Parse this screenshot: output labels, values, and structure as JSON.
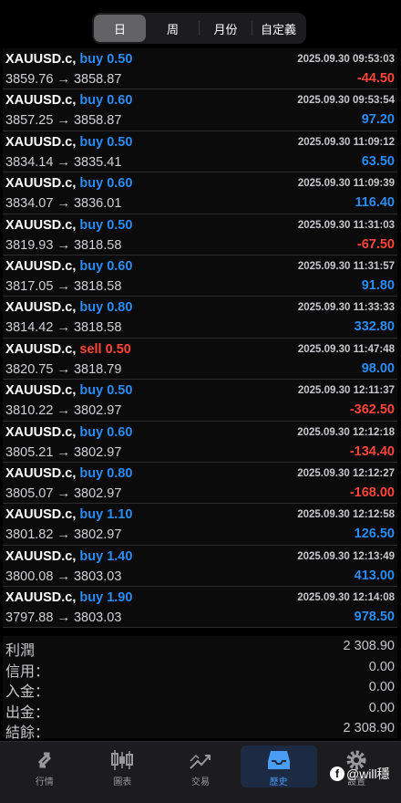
{
  "segments": [
    "日",
    "周",
    "月份",
    "自定義"
  ],
  "trades": [
    {
      "symbol": "XAUUSD.c,",
      "side": "buy",
      "lot": "0.50",
      "time": "2025.09.30 09:53:03",
      "prices": "3859.76 → 3858.87",
      "profit": "-44.50"
    },
    {
      "symbol": "XAUUSD.c,",
      "side": "buy",
      "lot": "0.60",
      "time": "2025.09.30 09:53:54",
      "prices": "3857.25 → 3858.87",
      "profit": "97.20"
    },
    {
      "symbol": "XAUUSD.c,",
      "side": "buy",
      "lot": "0.50",
      "time": "2025.09.30 11:09:12",
      "prices": "3834.14 → 3835.41",
      "profit": "63.50"
    },
    {
      "symbol": "XAUUSD.c,",
      "side": "buy",
      "lot": "0.60",
      "time": "2025.09.30 11:09:39",
      "prices": "3834.07 → 3836.01",
      "profit": "116.40"
    },
    {
      "symbol": "XAUUSD.c,",
      "side": "buy",
      "lot": "0.50",
      "time": "2025.09.30 11:31:03",
      "prices": "3819.93 → 3818.58",
      "profit": "-67.50"
    },
    {
      "symbol": "XAUUSD.c,",
      "side": "buy",
      "lot": "0.60",
      "time": "2025.09.30 11:31:57",
      "prices": "3817.05 → 3818.58",
      "profit": "91.80"
    },
    {
      "symbol": "XAUUSD.c,",
      "side": "buy",
      "lot": "0.80",
      "time": "2025.09.30 11:33:33",
      "prices": "3814.42 → 3818.58",
      "profit": "332.80"
    },
    {
      "symbol": "XAUUSD.c,",
      "side": "sell",
      "lot": "0.50",
      "time": "2025.09.30 11:47:48",
      "prices": "3820.75 → 3818.79",
      "profit": "98.00"
    },
    {
      "symbol": "XAUUSD.c,",
      "side": "buy",
      "lot": "0.50",
      "time": "2025.09.30 12:11:37",
      "prices": "3810.22 → 3802.97",
      "profit": "-362.50"
    },
    {
      "symbol": "XAUUSD.c,",
      "side": "buy",
      "lot": "0.60",
      "time": "2025.09.30 12:12:18",
      "prices": "3805.21 → 3802.97",
      "profit": "-134.40"
    },
    {
      "symbol": "XAUUSD.c,",
      "side": "buy",
      "lot": "0.80",
      "time": "2025.09.30 12:12:27",
      "prices": "3805.07 → 3802.97",
      "profit": "-168.00"
    },
    {
      "symbol": "XAUUSD.c,",
      "side": "buy",
      "lot": "1.10",
      "time": "2025.09.30 12:12:58",
      "prices": "3801.82 → 3802.97",
      "profit": "126.50"
    },
    {
      "symbol": "XAUUSD.c,",
      "side": "buy",
      "lot": "1.40",
      "time": "2025.09.30 12:13:49",
      "prices": "3800.08 → 3803.03",
      "profit": "413.00"
    },
    {
      "symbol": "XAUUSD.c,",
      "side": "buy",
      "lot": "1.90",
      "time": "2025.09.30 12:14:08",
      "prices": "3797.88 → 3803.03",
      "profit": "978.50"
    }
  ],
  "summary": [
    {
      "label": "利潤",
      "value": "2 308.90"
    },
    {
      "label": "信用：",
      "value": "0.00"
    },
    {
      "label": "入金：",
      "value": "0.00"
    },
    {
      "label": "出金：",
      "value": "0.00"
    },
    {
      "label": "結餘：",
      "value": "2 308.90"
    }
  ],
  "tabs": [
    {
      "label": "行情",
      "icon": "quotes-arrows-icon"
    },
    {
      "label": "圖表",
      "icon": "candlestick-chart-icon"
    },
    {
      "label": "交易",
      "icon": "trade-trend-icon"
    },
    {
      "label": "歷史",
      "icon": "history-inbox-icon"
    },
    {
      "label": "設置",
      "icon": "gear-icon"
    }
  ],
  "watermark": {
    "text": "@will穩",
    "icon_char": "f"
  },
  "colors": {
    "positive": "#2b8cf2",
    "negative": "#ff453a",
    "active_tab": "#4a9df5"
  }
}
